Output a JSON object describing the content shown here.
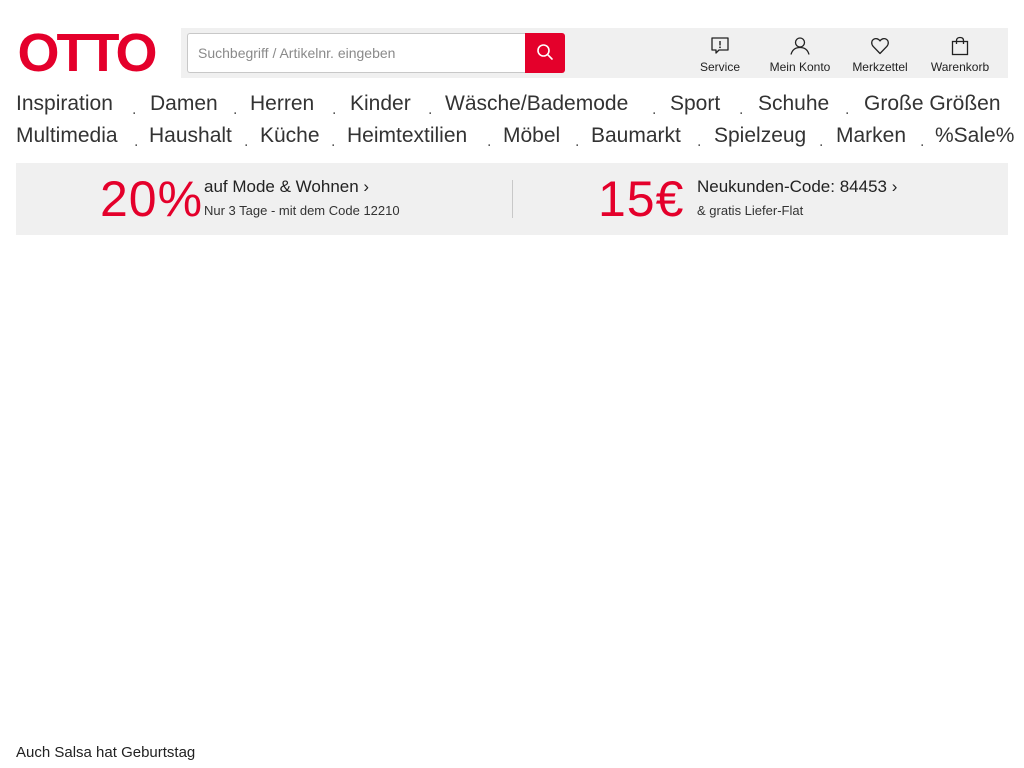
{
  "brand": {
    "logo_text": "OTTO",
    "color": "#e4002b"
  },
  "search": {
    "placeholder": "Suchbegriff / Artikelnr. eingeben",
    "value": "",
    "icon": "search-icon"
  },
  "header_tools": [
    {
      "label": "Service",
      "icon": "service-icon"
    },
    {
      "label": "Mein Konto",
      "icon": "user-icon"
    },
    {
      "label": "Merkzettel",
      "icon": "heart-icon"
    },
    {
      "label": "Warenkorb",
      "icon": "bag-icon"
    }
  ],
  "nav": {
    "row1": [
      "Inspiration",
      "Damen",
      "Herren",
      "Kinder",
      "Wäsche/Bademode",
      "Sport",
      "Schuhe",
      "Große Größen"
    ],
    "row2": [
      "Multimedia",
      "Haushalt",
      "Küche",
      "Heimtextilien",
      "Möbel",
      "Baumarkt",
      "Spielzeug",
      "Marken",
      "%Sale%"
    ],
    "separator": "."
  },
  "promo": {
    "left": {
      "big": "20%",
      "title": "auf Mode & Wohnen ›",
      "subtitle": "Nur 3 Tage - mit dem Code 12210"
    },
    "right": {
      "big": "15€",
      "title": "Neukunden-Code: 84453 ›",
      "subtitle": "& gratis Liefer-Flat"
    }
  },
  "footer": {
    "text": "Auch Salsa hat Geburtstag"
  }
}
